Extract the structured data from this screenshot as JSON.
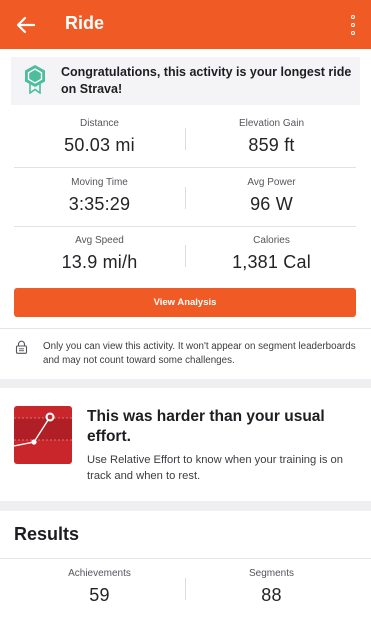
{
  "appbar": {
    "title": "Ride",
    "back_icon": "arrow-left-icon",
    "menu_icon": "more-vertical-icon",
    "color": "#f05a24"
  },
  "banner": {
    "icon": "achievement-badge-icon",
    "text": "Congratulations, this activity is your longest ride on Strava!"
  },
  "stats": {
    "distance": {
      "label": "Distance",
      "value": "50.03 mi"
    },
    "elevation": {
      "label": "Elevation Gain",
      "value": "859 ft"
    },
    "moving_time": {
      "label": "Moving Time",
      "value": "3:35:29"
    },
    "avg_power": {
      "label": "Avg Power",
      "value": "96 W"
    },
    "avg_speed": {
      "label": "Avg Speed",
      "value": "13.9 mi/h"
    },
    "calories": {
      "label": "Calories",
      "value": "1,381 Cal"
    }
  },
  "actions": {
    "view_analysis": "View Analysis"
  },
  "privacy": {
    "icon": "lock-icon",
    "text": "Only you can view this activity. It won't appear on segment leaderboards and may not count toward some challenges."
  },
  "effort": {
    "icon": "relative-effort-chart-icon",
    "title": "This was harder than your usual effort.",
    "description": "Use Relative Effort to know when your training is on track and when to rest."
  },
  "results": {
    "title": "Results",
    "achievements": {
      "label": "Achievements",
      "value": "59"
    },
    "segments": {
      "label": "Segments",
      "value": "88"
    }
  }
}
